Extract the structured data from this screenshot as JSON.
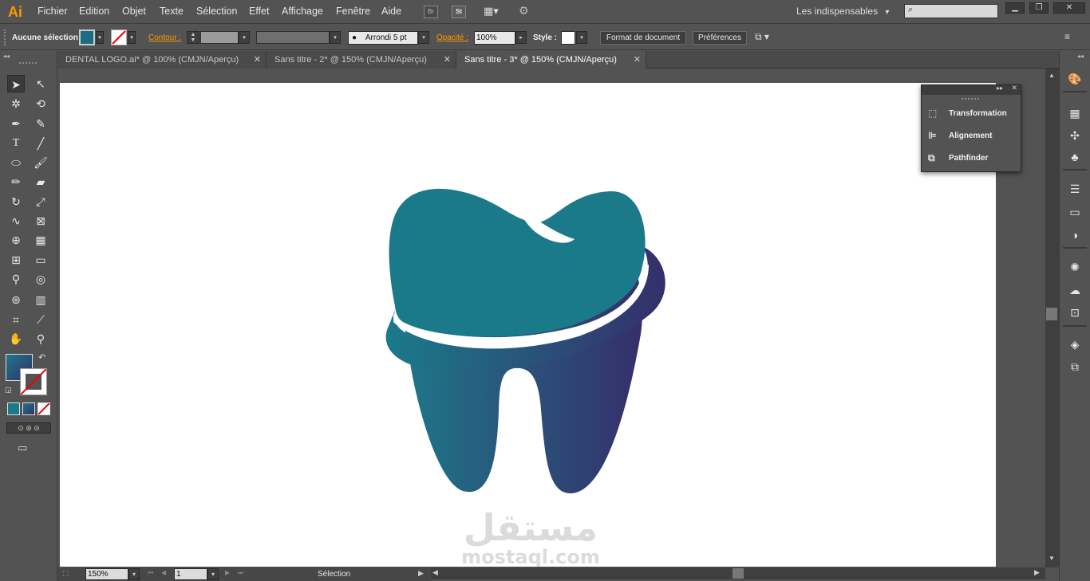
{
  "app": {
    "logo": "Ai"
  },
  "menu": [
    "Fichier",
    "Edition",
    "Objet",
    "Texte",
    "Sélection",
    "Effet",
    "Affichage",
    "Fenêtre",
    "Aide"
  ],
  "menubar_buttons": {
    "bridge": "Br",
    "stock": "St"
  },
  "workspace": {
    "label": "Les indispensables",
    "chevron": "▾"
  },
  "window_controls": {
    "minimize": "▁",
    "restore": "❐",
    "close": "✕"
  },
  "control": {
    "selection_label": "Aucune sélection",
    "contour_label": "Contour :",
    "brush_label": "Arrondi 5 pt",
    "opacity_label": "Opacité :",
    "opacity_value": "100%",
    "style_label": "Style :",
    "doc_format_button": "Format de document",
    "preferences_button": "Préférences",
    "fill_color": "#1b6d86"
  },
  "tabs": [
    {
      "label": "DENTAL LOGO.ai* @ 100% (CMJN/Aperçu)",
      "close": "✕",
      "active": false
    },
    {
      "label": "Sans titre - 2* @ 150% (CMJN/Aperçu)",
      "close": "✕",
      "active": false
    },
    {
      "label": "Sans titre - 3* @ 150% (CMJN/Aperçu)",
      "close": "✕",
      "active": true
    }
  ],
  "panel": {
    "items": [
      {
        "label": "Transformation",
        "icon": "transform-icon"
      },
      {
        "label": "Alignement",
        "icon": "align-icon"
      },
      {
        "label": "Pathfinder",
        "icon": "pathfinder-icon"
      }
    ]
  },
  "status": {
    "zoom": "150%",
    "page": "1",
    "tool": "Sélection"
  },
  "watermark": {
    "arabic": "مستقل",
    "latin": "mostaql.com"
  },
  "colors": {
    "tooth_top": "#1b7a8a",
    "tooth_gradient_left": "#1e7689",
    "tooth_gradient_right": "#352f6a",
    "ui_bg": "#535353",
    "accent_orange": "#ff9a00"
  }
}
